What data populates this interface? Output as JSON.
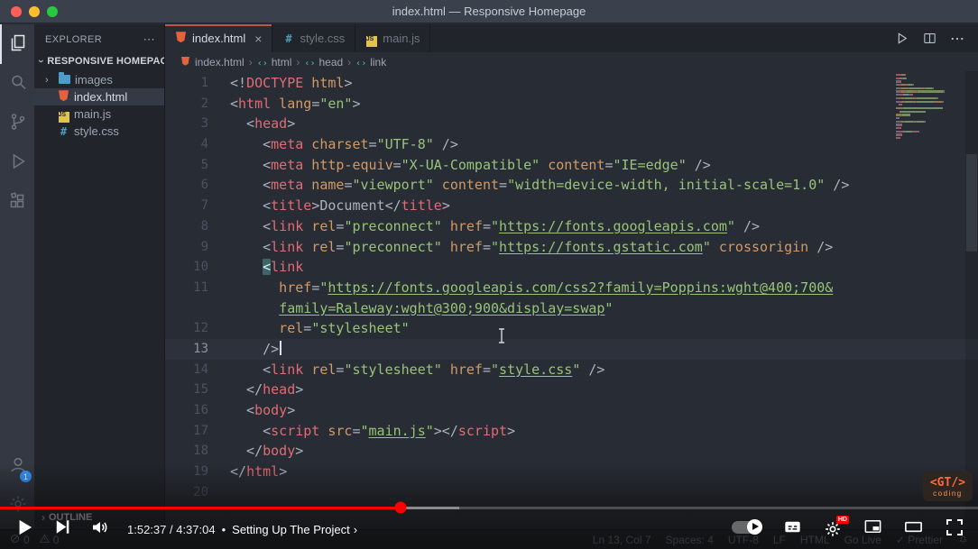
{
  "window": {
    "title": "index.html — Responsive Homepage"
  },
  "activity_bar": {
    "top": [
      {
        "icon": "explorer",
        "active": true
      },
      {
        "icon": "search"
      },
      {
        "icon": "source-control"
      },
      {
        "icon": "run-debug"
      },
      {
        "icon": "extensions"
      }
    ],
    "bottom": [
      {
        "icon": "account",
        "badge": "1"
      },
      {
        "icon": "gear"
      }
    ]
  },
  "sidebar": {
    "title": "EXPLORER",
    "menu": "⋯",
    "section": "RESPONSIVE HOMEPAGE",
    "files": [
      {
        "label": "images",
        "icon": "folder",
        "chevron": "›"
      },
      {
        "label": "index.html",
        "icon": "html",
        "selected": true
      },
      {
        "label": "main.js",
        "icon": "js"
      },
      {
        "label": "style.css",
        "icon": "css"
      }
    ],
    "outline": "OUTLINE"
  },
  "tabs": [
    {
      "label": "index.html",
      "icon": "html",
      "active": true,
      "close": "×"
    },
    {
      "label": "style.css",
      "icon": "css"
    },
    {
      "label": "main.js",
      "icon": "js"
    }
  ],
  "editor_actions": [
    {
      "icon": "run"
    },
    {
      "icon": "split"
    },
    {
      "icon": "more"
    }
  ],
  "breadcrumbs": [
    {
      "label": "index.html",
      "icon": "html"
    },
    {
      "label": "html",
      "icon": "symbol"
    },
    {
      "label": "head",
      "icon": "symbol"
    },
    {
      "label": "link",
      "icon": "symbol"
    }
  ],
  "code": {
    "rows": [
      {
        "n": "1",
        "t": [
          [
            "p",
            "<!"
          ],
          [
            "t",
            "DOCTYPE"
          ],
          [
            "a",
            " html"
          ],
          [
            "p",
            ">"
          ]
        ]
      },
      {
        "n": "2",
        "t": [
          [
            "p",
            "<"
          ],
          [
            "t",
            "html"
          ],
          [
            "a",
            " lang"
          ],
          [
            "p",
            "="
          ],
          [
            "s",
            "\"en\""
          ],
          [
            "p",
            ">"
          ]
        ]
      },
      {
        "n": "3",
        "t": [
          [
            "p",
            "  <"
          ],
          [
            "t",
            "head"
          ],
          [
            "p",
            ">"
          ]
        ]
      },
      {
        "n": "4",
        "t": [
          [
            "p",
            "    <"
          ],
          [
            "t",
            "meta"
          ],
          [
            "a",
            " charset"
          ],
          [
            "p",
            "="
          ],
          [
            "s",
            "\"UTF-8\""
          ],
          [
            "p",
            " />"
          ]
        ]
      },
      {
        "n": "5",
        "t": [
          [
            "p",
            "    <"
          ],
          [
            "t",
            "meta"
          ],
          [
            "a",
            " http-equiv"
          ],
          [
            "p",
            "="
          ],
          [
            "s",
            "\"X-UA-Compatible\""
          ],
          [
            "a",
            " content"
          ],
          [
            "p",
            "="
          ],
          [
            "s",
            "\"IE=edge\""
          ],
          [
            "p",
            " />"
          ]
        ]
      },
      {
        "n": "6",
        "t": [
          [
            "p",
            "    <"
          ],
          [
            "t",
            "meta"
          ],
          [
            "a",
            " name"
          ],
          [
            "p",
            "="
          ],
          [
            "s",
            "\"viewport\""
          ],
          [
            "a",
            " content"
          ],
          [
            "p",
            "="
          ],
          [
            "s",
            "\"width=device-width, initial-scale=1.0\""
          ],
          [
            "p",
            " />"
          ]
        ]
      },
      {
        "n": "7",
        "t": [
          [
            "p",
            "    <"
          ],
          [
            "t",
            "title"
          ],
          [
            "p",
            ">"
          ],
          [
            "x",
            "Document"
          ],
          [
            "p",
            "</"
          ],
          [
            "t",
            "title"
          ],
          [
            "p",
            ">"
          ]
        ]
      },
      {
        "n": "8",
        "t": [
          [
            "p",
            "    <"
          ],
          [
            "t",
            "link"
          ],
          [
            "a",
            " rel"
          ],
          [
            "p",
            "="
          ],
          [
            "s",
            "\"preconnect\""
          ],
          [
            "a",
            " href"
          ],
          [
            "p",
            "="
          ],
          [
            "s",
            "\""
          ],
          [
            "l",
            "https://fonts.googleapis.com"
          ],
          [
            "s",
            "\""
          ],
          [
            "p",
            " />"
          ]
        ]
      },
      {
        "n": "9",
        "t": [
          [
            "p",
            "    <"
          ],
          [
            "t",
            "link"
          ],
          [
            "a",
            " rel"
          ],
          [
            "p",
            "="
          ],
          [
            "s",
            "\"preconnect\""
          ],
          [
            "a",
            " href"
          ],
          [
            "p",
            "="
          ],
          [
            "s",
            "\""
          ],
          [
            "l",
            "https://fonts.gstatic.com"
          ],
          [
            "s",
            "\""
          ],
          [
            "a",
            " crossorigin"
          ],
          [
            "p",
            " />"
          ]
        ]
      },
      {
        "n": "10",
        "t": [
          [
            "p",
            "    "
          ],
          [
            "hl",
            "<"
          ],
          [
            "t",
            "link"
          ]
        ]
      },
      {
        "n": "11",
        "t": [
          [
            "a",
            "      href"
          ],
          [
            "p",
            "="
          ],
          [
            "s",
            "\""
          ],
          [
            "l",
            "https://fonts.googleapis.com/css2?family=Poppins:wght@400;700&"
          ]
        ]
      },
      {
        "n": "",
        "t": [
          [
            "x",
            "      "
          ],
          [
            "l",
            "family=Raleway:wght@300;900&display=swap"
          ],
          [
            "s",
            "\""
          ]
        ]
      },
      {
        "n": "12",
        "t": [
          [
            "a",
            "      rel"
          ],
          [
            "p",
            "="
          ],
          [
            "s",
            "\"stylesheet\""
          ]
        ]
      },
      {
        "n": "13",
        "current": true,
        "caret": true,
        "t": [
          [
            "p",
            "    />"
          ]
        ]
      },
      {
        "n": "14",
        "t": [
          [
            "p",
            "    <"
          ],
          [
            "t",
            "link"
          ],
          [
            "a",
            " rel"
          ],
          [
            "p",
            "="
          ],
          [
            "s",
            "\"stylesheet\""
          ],
          [
            "a",
            " href"
          ],
          [
            "p",
            "="
          ],
          [
            "s",
            "\""
          ],
          [
            "l",
            "style.css"
          ],
          [
            "s",
            "\""
          ],
          [
            "p",
            " />"
          ]
        ]
      },
      {
        "n": "15",
        "t": [
          [
            "p",
            "  </"
          ],
          [
            "t",
            "head"
          ],
          [
            "p",
            ">"
          ]
        ]
      },
      {
        "n": "16",
        "t": [
          [
            "p",
            "  <"
          ],
          [
            "t",
            "body"
          ],
          [
            "p",
            ">"
          ]
        ]
      },
      {
        "n": "17",
        "t": [
          [
            "p",
            "    <"
          ],
          [
            "t",
            "script"
          ],
          [
            "a",
            " src"
          ],
          [
            "p",
            "="
          ],
          [
            "s",
            "\""
          ],
          [
            "l",
            "main.js"
          ],
          [
            "s",
            "\""
          ],
          [
            "p",
            "></"
          ],
          [
            "t",
            "scr"
          ],
          [
            "t",
            "ipt"
          ],
          [
            "p",
            ">"
          ]
        ]
      },
      {
        "n": "18",
        "t": [
          [
            "p",
            "  </"
          ],
          [
            "t",
            "body"
          ],
          [
            "p",
            ">"
          ]
        ]
      },
      {
        "n": "19",
        "t": [
          [
            "p",
            "</"
          ],
          [
            "t",
            "html"
          ],
          [
            "p",
            ">"
          ]
        ]
      },
      {
        "n": "20",
        "t": []
      }
    ]
  },
  "status_bar": {
    "problems": [
      {
        "icon": "error",
        "count": "0"
      },
      {
        "icon": "warning",
        "count": "0"
      }
    ],
    "items": [
      "Ln 13, Col 7",
      "Spaces: 4",
      "UTF-8",
      "LF",
      "HTML",
      "Go Live",
      "✓ Prettier"
    ]
  },
  "player": {
    "time": "1:52:37 / 4:37:04",
    "bullet": "•",
    "chapter": "Setting Up The Project",
    "chevron": "›",
    "progress_percent": 41,
    "buffer_percent": 47,
    "hd_badge": "HD",
    "accent": "#ff0000",
    "left_controls": [
      "play",
      "next",
      "volume"
    ],
    "right_controls": [
      "autoplay",
      "cc",
      "settings",
      "miniplayer",
      "theater",
      "fullscreen"
    ]
  },
  "watermark": {
    "logo": "<GT/>",
    "sub": "coding"
  }
}
